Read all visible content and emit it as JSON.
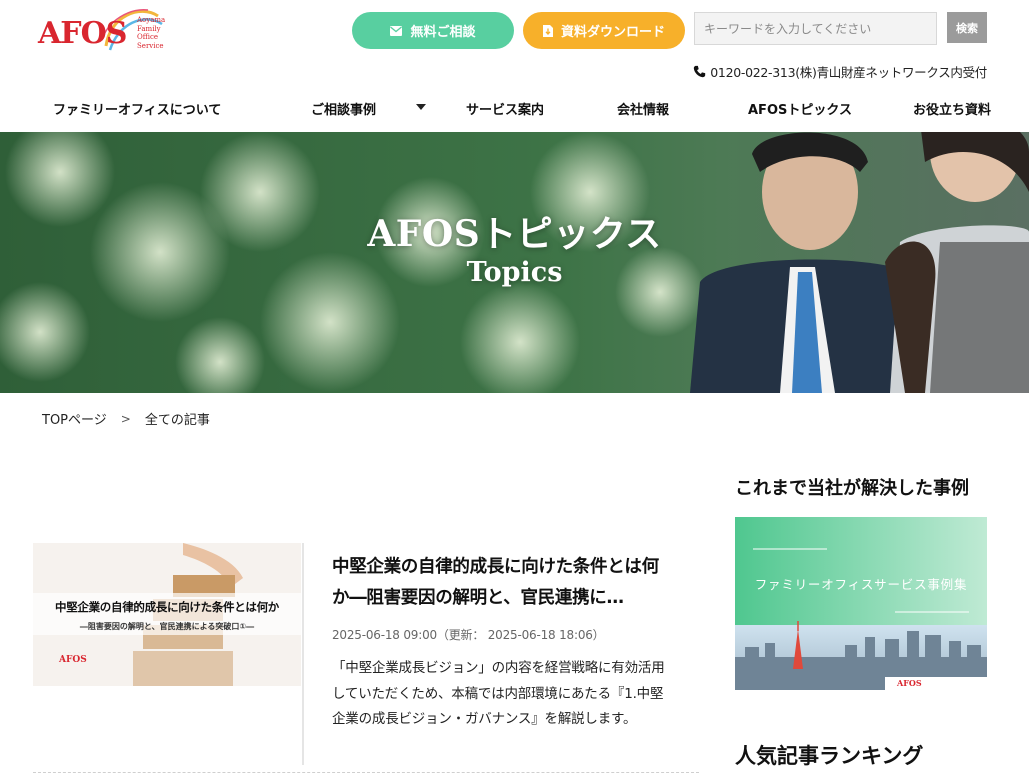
{
  "header": {
    "logo_text": "AFOS",
    "logo_tagline": "Aoyama\nFamily\nOffice\nService",
    "consult_button": "無料ご相談",
    "download_button": "資料ダウンロード",
    "search_placeholder": "キーワードを入力してください",
    "search_button": "検索",
    "phone": "0120-022-313(株)青山財産ネットワークス内受付",
    "brand_red": "#d9262f",
    "consult_color": "#58cfa0",
    "download_color": "#f7b02a"
  },
  "nav": [
    {
      "label": "ファミリーオフィスについて"
    },
    {
      "label": "ご相談事例"
    },
    {
      "label": "サービス案内"
    },
    {
      "label": "会社情報"
    },
    {
      "label": "AFOSトピックス"
    },
    {
      "label": "お役立ち資料"
    }
  ],
  "hero": {
    "title": "AFOSトピックス",
    "subtitle": "Topics"
  },
  "breadcrumb": {
    "home": "TOPページ",
    "separator": ">",
    "current": "全ての記事"
  },
  "article": {
    "thumb_title": "中堅企業の自律的成長に向けた条件とは何か",
    "thumb_subtitle": "―阻害要因の解明と、官民連携による突破口①―",
    "thumb_logo": "AFOS",
    "title": "中堅企業の自律的成長に向けた条件とは何か―阻害要因の解明と、官民連携に…",
    "date": "2025-06-18 09:00（更新： 2025-06-18 18:06）",
    "excerpt": "「中堅企業成長ビジョン」の内容を経営戦略に有効活用していただくため、本稿では内部環境にあたる『1.中堅企業の成長ビジョン・ガバナンス』を解説します。"
  },
  "sidebar": {
    "solved_heading": "これまで当社が解決した事例",
    "banner_text": "ファミリーオフィスサービス事例集",
    "banner_logo": "AFOS",
    "ranking_heading": "人気記事ランキング"
  }
}
